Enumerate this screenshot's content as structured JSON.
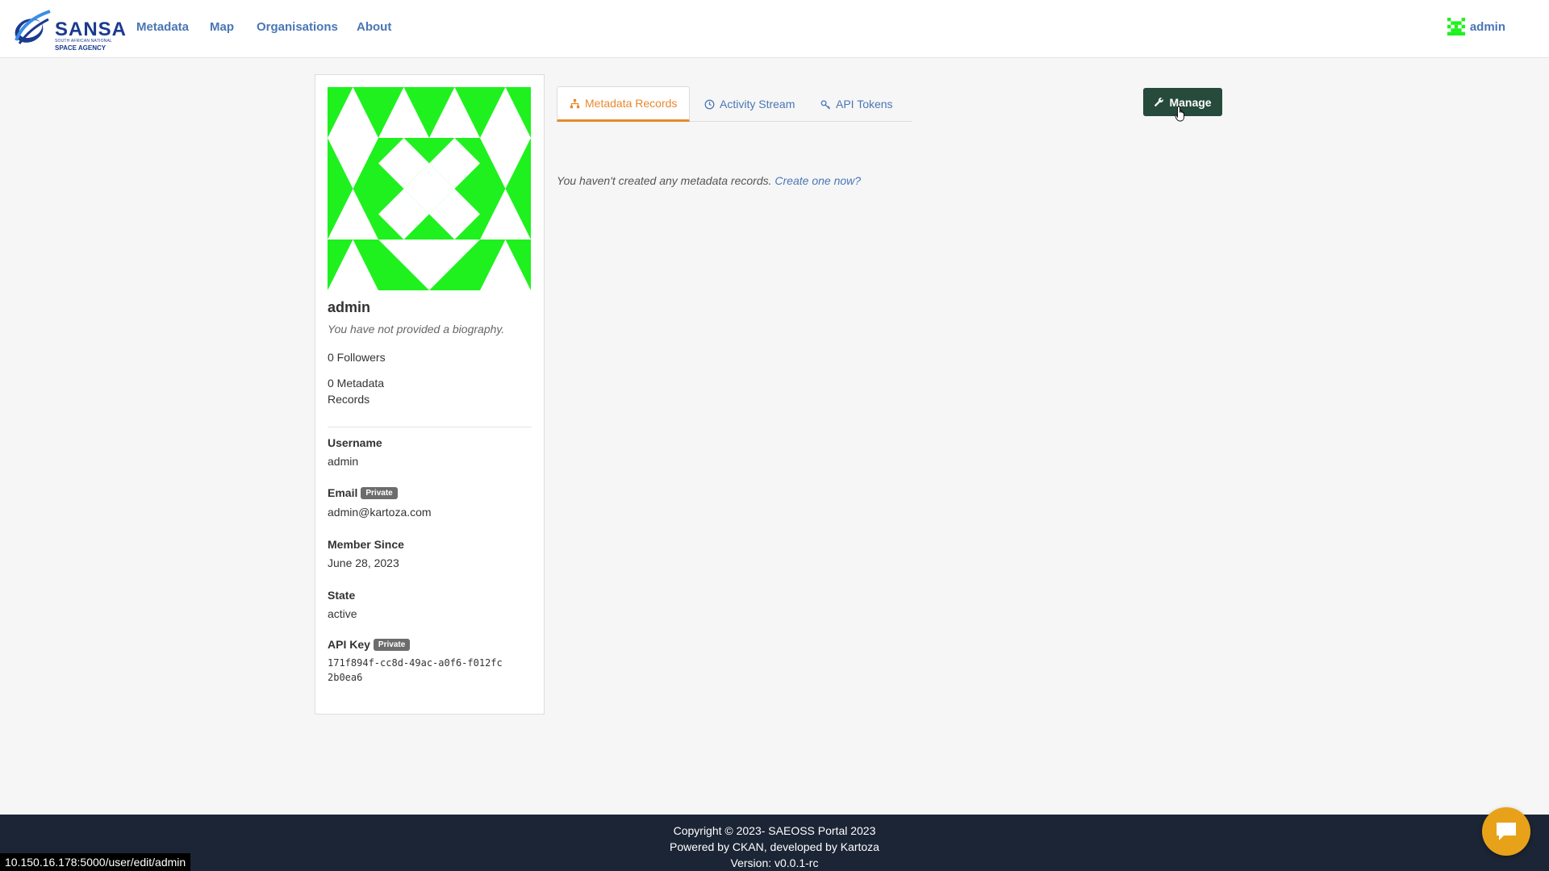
{
  "brand": {
    "logo_text": "SANSA",
    "logo_sub1": "SOUTH AFRICAN NATIONAL",
    "logo_sub2": "SPACE AGENCY"
  },
  "nav": {
    "items": [
      {
        "label": "Metadata"
      },
      {
        "label": "Map"
      },
      {
        "label": "Organisations"
      },
      {
        "label": "About"
      }
    ],
    "user_label": "admin"
  },
  "profile": {
    "name": "admin",
    "bio": "You have not provided a biography.",
    "followers": "0 Followers",
    "records": "0 Metadata Records",
    "fields": {
      "username_label": "Username",
      "username_value": "admin",
      "email_label": "Email",
      "email_badge": "Private",
      "email_value": "admin@kartoza.com",
      "member_since_label": "Member Since",
      "member_since_value": "June 28, 2023",
      "state_label": "State",
      "state_value": "active",
      "api_key_label": "API Key",
      "api_key_badge": "Private",
      "api_key_value": "171f894f-cc8d-49ac-a0f6-f012fc2b0ea6"
    }
  },
  "tabs": [
    {
      "label": "Metadata Records",
      "icon": "sitemap-icon",
      "active": true
    },
    {
      "label": "Activity Stream",
      "icon": "clock-icon",
      "active": false
    },
    {
      "label": "API Tokens",
      "icon": "key-icon",
      "active": false
    }
  ],
  "manage_label": "Manage",
  "empty": {
    "message": "You haven't created any metadata records.",
    "link": "Create one now?"
  },
  "footer": {
    "line1": "Copyright © 2023- SAEOSS Portal 2023",
    "line2": "Powered by CKAN, developed by Kartoza",
    "line3": "Version: v0.0.1-rc"
  },
  "status_url": "10.150.16.178:5000/user/edit/admin",
  "colors": {
    "accent": "#e8892e",
    "link": "#4a76b5",
    "manage_button": "#264a3c",
    "identicon": "#1ff11f",
    "footer_bg": "#1c2535",
    "chat_button": "#e8a21a"
  }
}
